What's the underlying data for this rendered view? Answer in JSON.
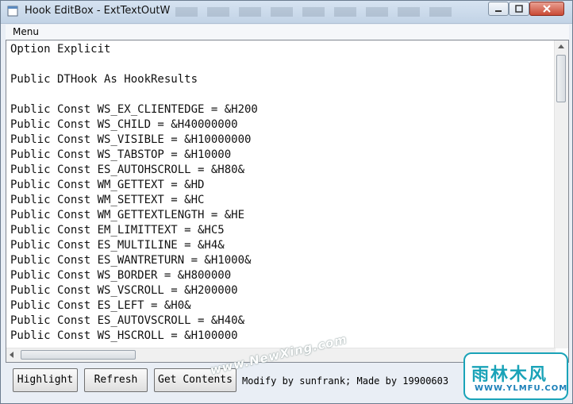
{
  "window": {
    "title": "Hook EditBox - ExtTextOutW"
  },
  "menubar": {
    "menu_label": "Menu"
  },
  "editor": {
    "lines": [
      "Option Explicit",
      "",
      "Public DTHook As HookResults",
      "",
      "Public Const WS_EX_CLIENTEDGE = &H200",
      "Public Const WS_CHILD = &H40000000",
      "Public Const WS_VISIBLE = &H10000000",
      "Public Const WS_TABSTOP = &H10000",
      "Public Const ES_AUTOHSCROLL = &H80&",
      "Public Const WM_GETTEXT = &HD",
      "Public Const WM_SETTEXT = &HC",
      "Public Const WM_GETTEXTLENGTH = &HE",
      "Public Const EM_LIMITTEXT = &HC5",
      "Public Const ES_MULTILINE = &H4&",
      "Public Const ES_WANTRETURN = &H1000&",
      "Public Const WS_BORDER = &H800000",
      "Public Const WS_VSCROLL = &H200000",
      "Public Const ES_LEFT = &H0&",
      "Public Const ES_AUTOVSCROLL = &H40&",
      "Public Const WS_HSCROLL = &H100000"
    ]
  },
  "buttons": {
    "highlight": "Highlight",
    "refresh": "Refresh",
    "get_contents": "Get Contents"
  },
  "footer": {
    "credit": "Modify by sunfrank; Made by 19900603"
  },
  "watermarks": {
    "diagonal": "www.NewXing.com",
    "logo_main": "雨林木风",
    "logo_sub": "WWW.YLMFU.COM"
  },
  "icons": {
    "app": "app-window-icon",
    "minimize": "minimize-icon",
    "maximize": "maximize-icon",
    "close": "close-icon"
  },
  "colors": {
    "accent": "#1aa3b8"
  }
}
